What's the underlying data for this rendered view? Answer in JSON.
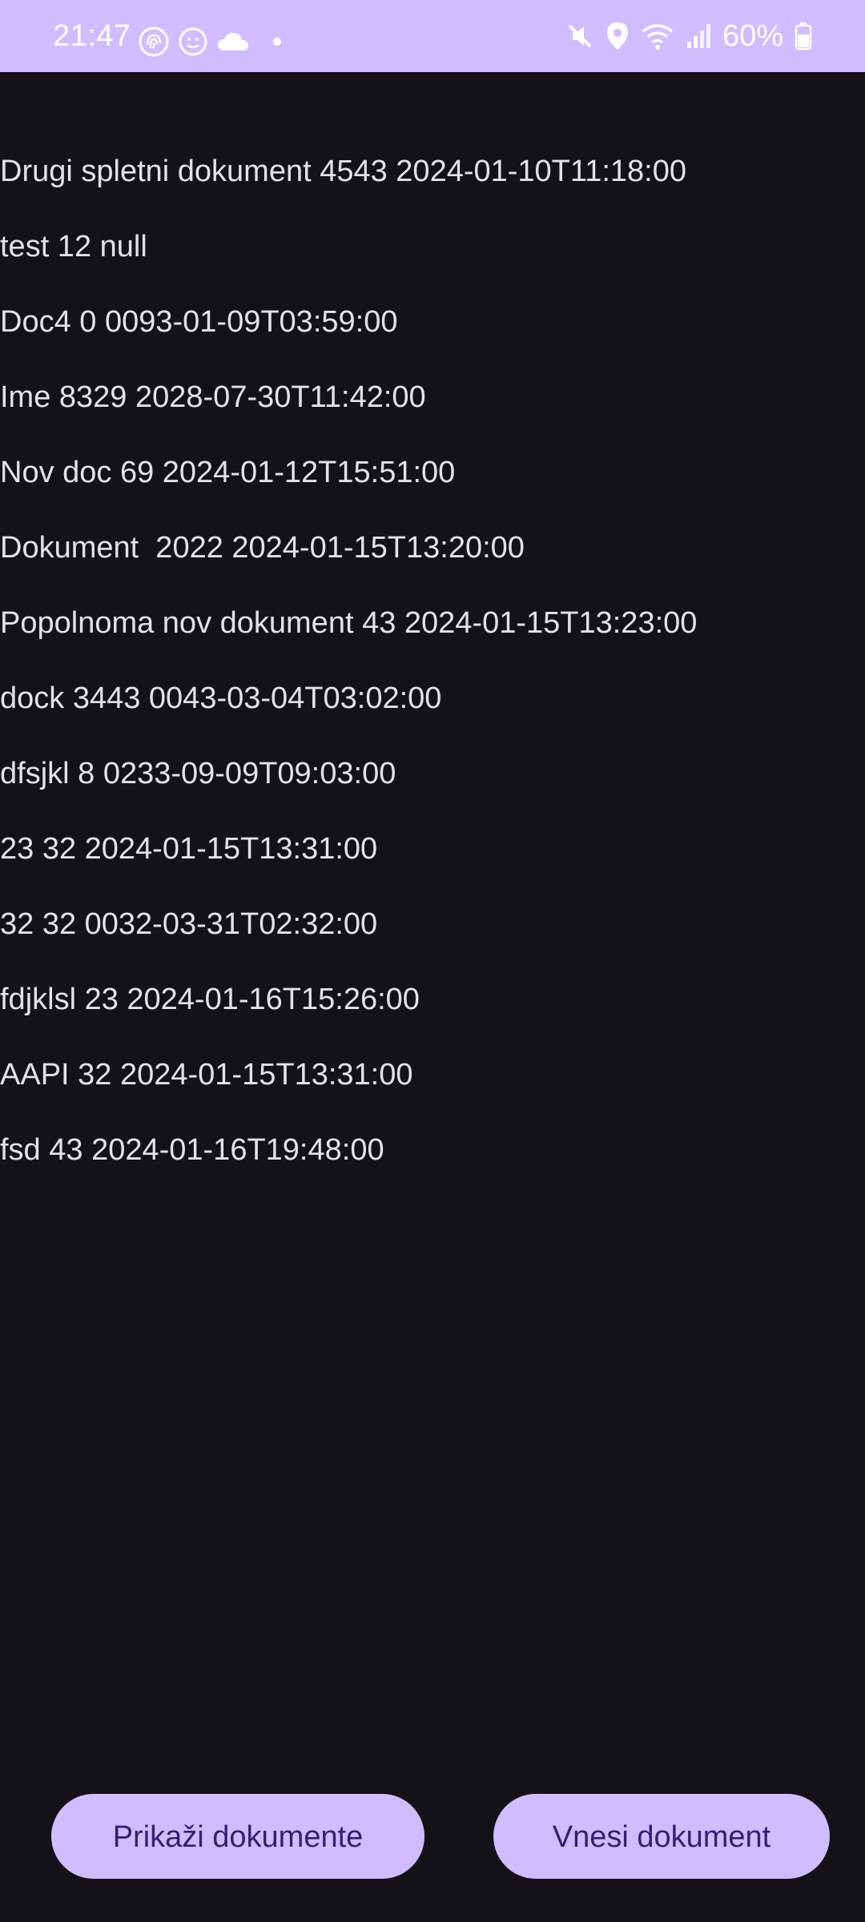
{
  "status_bar": {
    "time": "21:47",
    "battery_text": "60%",
    "left_icons": [
      "fingerprint-icon",
      "smiley-icon",
      "cloud-icon",
      "dot-icon"
    ],
    "right_icons": [
      "mute-icon",
      "location-icon",
      "wifi-icon",
      "signal-icon",
      "battery-icon"
    ],
    "background": "#d0bcfe"
  },
  "documents": [
    "Drugi spletni dokument 4543 2024-01-10T11:18:00",
    "test 12 null",
    "Doc4 0 0093-01-09T03:59:00",
    "Ime 8329 2028-07-30T11:42:00",
    "Nov doc 69 2024-01-12T15:51:00",
    "Dokument  2022 2024-01-15T13:20:00",
    "Popolnoma nov dokument 43 2024-01-15T13:23:00",
    "dock 3443 0043-03-04T03:02:00",
    "dfsjkl 8 0233-09-09T09:03:00",
    "23 32 2024-01-15T13:31:00",
    "32 32 0032-03-31T02:32:00",
    "fdjklsl 23 2024-01-16T15:26:00",
    "AAPI 32 2024-01-15T13:31:00",
    "fsd 43 2024-01-16T19:48:00"
  ],
  "buttons": {
    "show_documents": "Prikaži dokumente",
    "insert_document": "Vnesi dokument"
  },
  "colors": {
    "background": "#141218",
    "text": "#e6e0e9",
    "button_bg": "#d0bcfe",
    "button_text": "#381e72"
  }
}
